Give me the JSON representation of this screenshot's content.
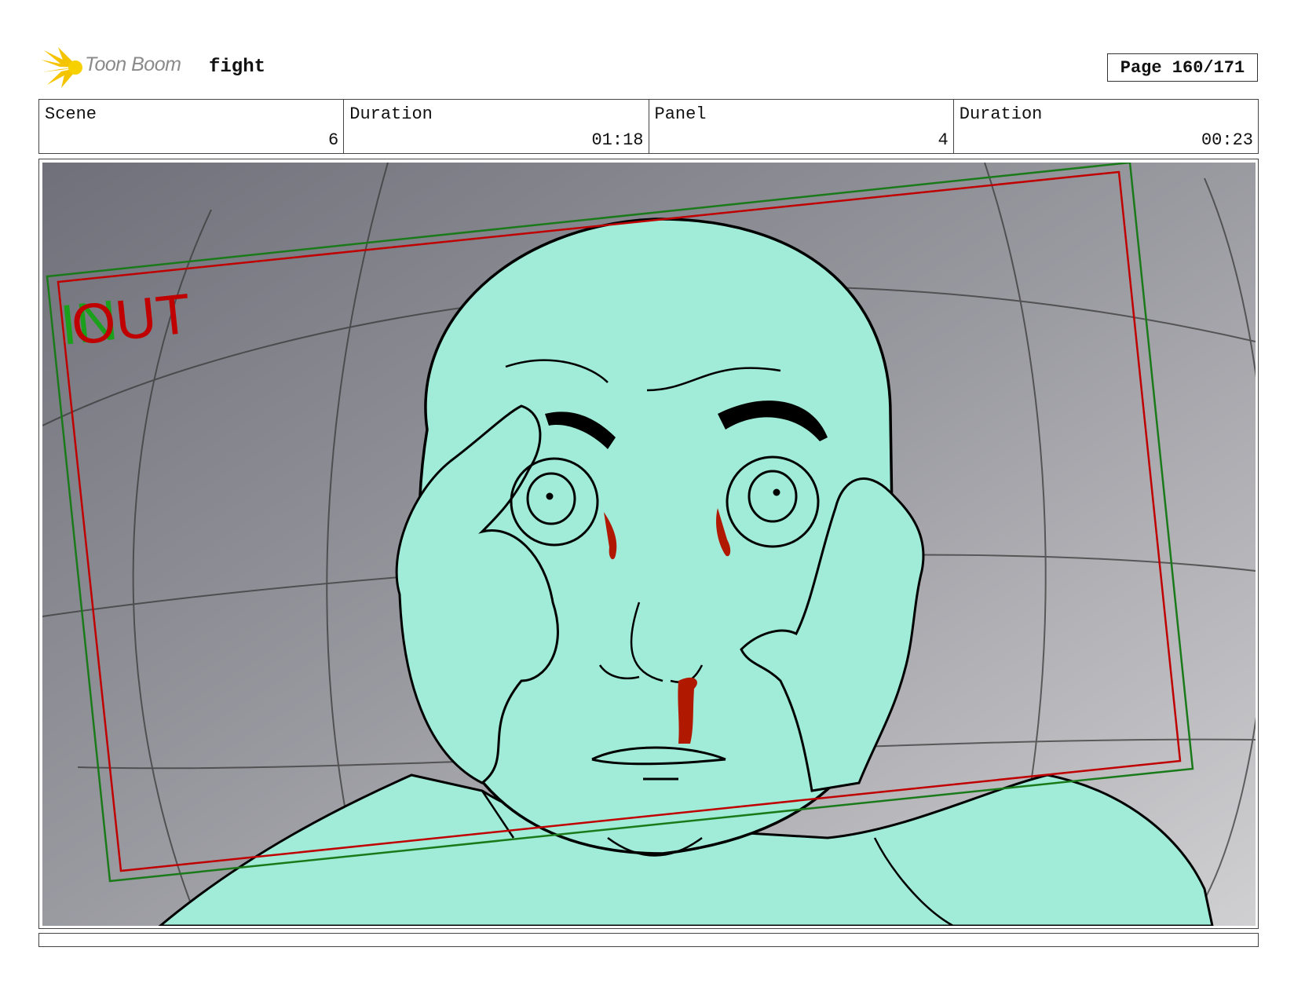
{
  "header": {
    "logo_text": "Toon Boom",
    "project_title": "fight",
    "page_label": "Page 160/171"
  },
  "info": {
    "scene_label": "Scene",
    "scene_value": "6",
    "scene_duration_label": "Duration",
    "scene_duration_value": "01:18",
    "panel_label": "Panel",
    "panel_value": "4",
    "panel_duration_label": "Duration",
    "panel_duration_value": "00:23"
  },
  "panel": {
    "in_marker": "IN",
    "out_marker": "OUT",
    "in_color": "#1aa01a",
    "out_color": "#c00000",
    "skin_color": "#a0ecd8",
    "blood_color": "#b01800"
  },
  "caption": {
    "text": ""
  }
}
